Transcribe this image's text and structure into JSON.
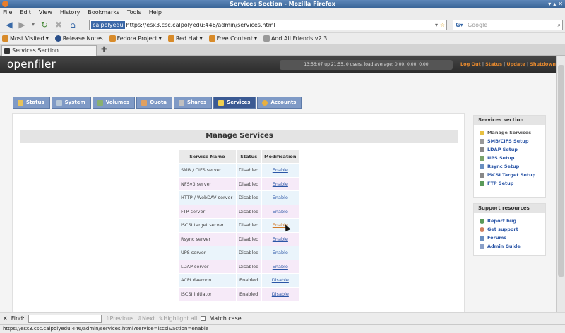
{
  "window": {
    "title": "Services Section - Mozilla Firefox"
  },
  "menu": [
    "File",
    "Edit",
    "View",
    "History",
    "Bookmarks",
    "Tools",
    "Help"
  ],
  "nav": {
    "identity": "calpolyedu",
    "url": "https://esx3.csc.calpolyedu:446/admin/services.html",
    "search_placeholder": "Google"
  },
  "bookmarks": [
    {
      "label": "Most Visited",
      "dropdown": true
    },
    {
      "label": "Release Notes",
      "dropdown": false
    },
    {
      "label": "Fedora Project",
      "dropdown": true
    },
    {
      "label": "Red Hat",
      "dropdown": true
    },
    {
      "label": "Free Content",
      "dropdown": true
    },
    {
      "label": "Add All Friends v2.3",
      "dropdown": false
    }
  ],
  "tabs": [
    {
      "label": "Services Section",
      "active": true
    }
  ],
  "app": {
    "logo": "openfiler",
    "status_line": "13:56:07 up 21:55, 0 users, load average: 0.00, 0.00, 0.00",
    "header_links": [
      "Log Out",
      "Status",
      "Update",
      "Shutdown"
    ],
    "nav_tabs": [
      {
        "label": "Status",
        "active": false
      },
      {
        "label": "System",
        "active": false
      },
      {
        "label": "Volumes",
        "active": false
      },
      {
        "label": "Quota",
        "active": false
      },
      {
        "label": "Shares",
        "active": false
      },
      {
        "label": "Services",
        "active": true
      },
      {
        "label": "Accounts",
        "active": false
      }
    ],
    "page_title": "Manage Services",
    "table": {
      "headers": [
        "Service Name",
        "Status",
        "Modification"
      ],
      "rows": [
        {
          "name": "SMB / CIFS server",
          "status": "Disabled",
          "action": "Enable"
        },
        {
          "name": "NFSv3 server",
          "status": "Disabled",
          "action": "Enable"
        },
        {
          "name": "HTTP / WebDAV server",
          "status": "Disabled",
          "action": "Enable"
        },
        {
          "name": "FTP server",
          "status": "Disabled",
          "action": "Enable"
        },
        {
          "name": "iSCSI target server",
          "status": "Disabled",
          "action": "Enable",
          "hover": true
        },
        {
          "name": "Rsync server",
          "status": "Disabled",
          "action": "Enable"
        },
        {
          "name": "UPS server",
          "status": "Disabled",
          "action": "Enable"
        },
        {
          "name": "LDAP server",
          "status": "Disabled",
          "action": "Enable"
        },
        {
          "name": "ACPI daemon",
          "status": "Enabled",
          "action": "Disable"
        },
        {
          "name": "iSCSI initiator",
          "status": "Enabled",
          "action": "Disable"
        }
      ]
    },
    "services_section": {
      "title": "Services section",
      "items": [
        "Manage Services",
        "SMB/CIFS Setup",
        "LDAP Setup",
        "UPS Setup",
        "Rsync Setup",
        "iSCSI Target Setup",
        "FTP Setup"
      ]
    },
    "support": {
      "title": "Support resources",
      "items": [
        "Report bug",
        "Get support",
        "Forums",
        "Admin Guide"
      ]
    }
  },
  "findbar": {
    "label": "Find:",
    "previous": "Previous",
    "next": "Next",
    "highlight": "Highlight all",
    "match_case": "Match case"
  },
  "statusbar": "https://esx3.csc.calpolyedu:446/admin/services.html?service=iscsi&action=enable"
}
